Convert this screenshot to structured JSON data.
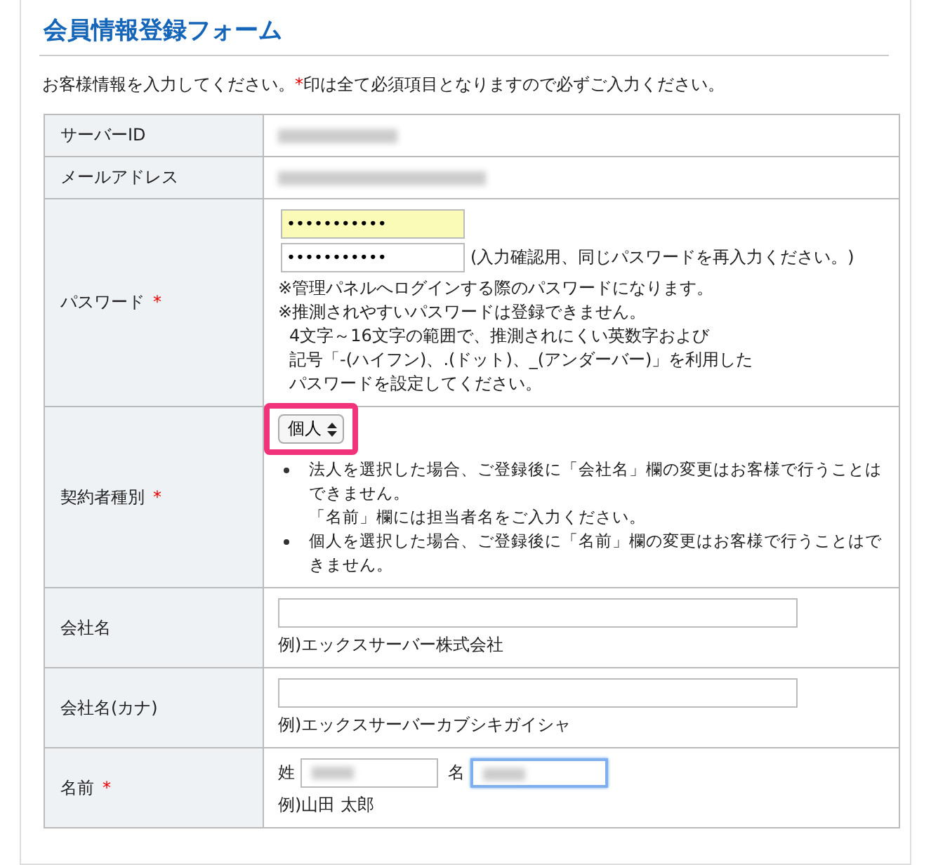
{
  "title": "会員情報登録フォーム",
  "intro": {
    "before": "お客様情報を入力してください。",
    "mark": "*",
    "after": "印は全て必須項目となりますので必ずご入力ください。"
  },
  "rows": [
    {
      "kind": "redacted",
      "label": "サーバーID",
      "required": false
    },
    {
      "kind": "redacted",
      "label": "メールアドレス",
      "required": false
    },
    {
      "kind": "password",
      "label": "パスワード",
      "required": true,
      "fields": [
        {
          "value": "•••••••••••",
          "autofilled": true
        },
        {
          "value": "•••••••••••",
          "autofilled": false,
          "hint": "(入力確認用、同じパスワードを再入力ください。)"
        }
      ],
      "notes": [
        {
          "kind": "note",
          "text": "※管理パネルへログインする際のパスワードになります。"
        },
        {
          "kind": "note",
          "text": "※推測されやすいパスワードは登録できません。"
        },
        {
          "kind": "sub",
          "text": "4文字～16文字の範囲で、推測されにくい英数字および"
        },
        {
          "kind": "sub",
          "text": "記号「-(ハイフン)、.(ドット)、_(アンダーバー)」を利用した"
        },
        {
          "kind": "sub",
          "text": "パスワードを設定してください。"
        }
      ]
    },
    {
      "kind": "select",
      "label": "契約者種別",
      "required": true,
      "value": "個人",
      "highlighted": true,
      "bullets": [
        {
          "lines": [
            "法人を選択した場合、ご登録後に「会社名」欄の変更はお客様で行うことはできません。",
            "「名前」欄には担当者名をご入力ください。"
          ]
        },
        {
          "lines": [
            "個人を選択した場合、ご登録後に「名前」欄の変更はお客様で行うことはできません。"
          ]
        }
      ]
    },
    {
      "kind": "text",
      "label": "会社名",
      "required": false,
      "example": "例)エックスサーバー株式会社"
    },
    {
      "kind": "text",
      "label": "会社名(カナ)",
      "required": false,
      "example": "例)エックスサーバーカブシキガイシャ"
    },
    {
      "kind": "name",
      "label": "名前",
      "required": true,
      "parts": [
        {
          "label": "姓",
          "focused": false
        },
        {
          "label": "名",
          "focused": true
        }
      ],
      "example": "例)山田 太郎"
    }
  ]
}
